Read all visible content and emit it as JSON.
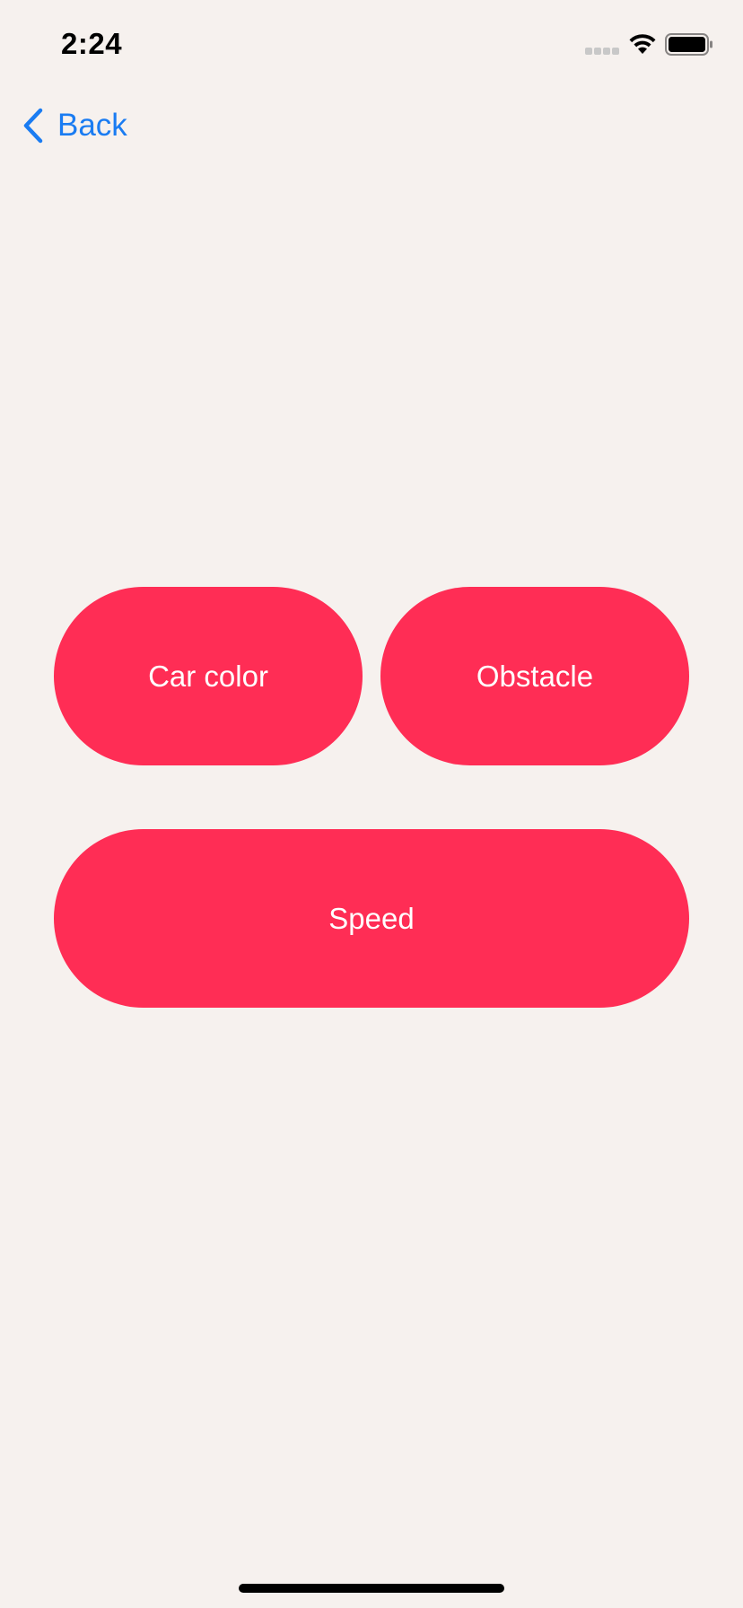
{
  "status_bar": {
    "time": "2:24",
    "icons": [
      "cellular-signal-icon",
      "wifi-icon",
      "battery-icon"
    ]
  },
  "nav": {
    "back_label": "Back",
    "back_icon": "chevron-left-icon",
    "accent_color": "#1a7cf2"
  },
  "buttons": {
    "car_color": "Car color",
    "obstacle": "Obstacle",
    "speed": "Speed",
    "color": "#ff2d55",
    "text_color": "#ffffff"
  },
  "theme": {
    "background": "#f6f1ee"
  }
}
